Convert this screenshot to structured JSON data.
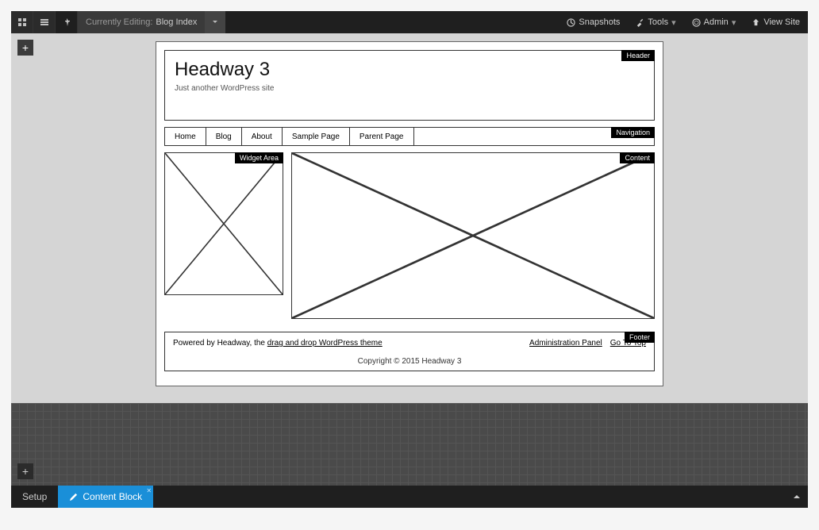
{
  "topbar": {
    "editing_label": "Currently Editing:",
    "editing_value": "Blog Index",
    "snapshots": "Snapshots",
    "tools": "Tools",
    "admin": "Admin",
    "view_site": "View Site"
  },
  "header": {
    "title": "Headway 3",
    "tagline": "Just another WordPress site",
    "block_label": "Header"
  },
  "navigation": {
    "block_label": "Navigation",
    "items": [
      "Home",
      "Blog",
      "About",
      "Sample Page",
      "Parent Page"
    ]
  },
  "widget_area": {
    "block_label": "Widget Area"
  },
  "content": {
    "block_label": "Content"
  },
  "footer": {
    "block_label": "Footer",
    "powered_by_prefix": "Powered by Headway, the ",
    "powered_by_link": "drag and drop WordPress theme",
    "admin_link": "Administration Panel",
    "go_top": "Go To Top",
    "copyright": "Copyright © 2015 Headway 3"
  },
  "bottombar": {
    "setup": "Setup",
    "content_block": "Content Block"
  }
}
